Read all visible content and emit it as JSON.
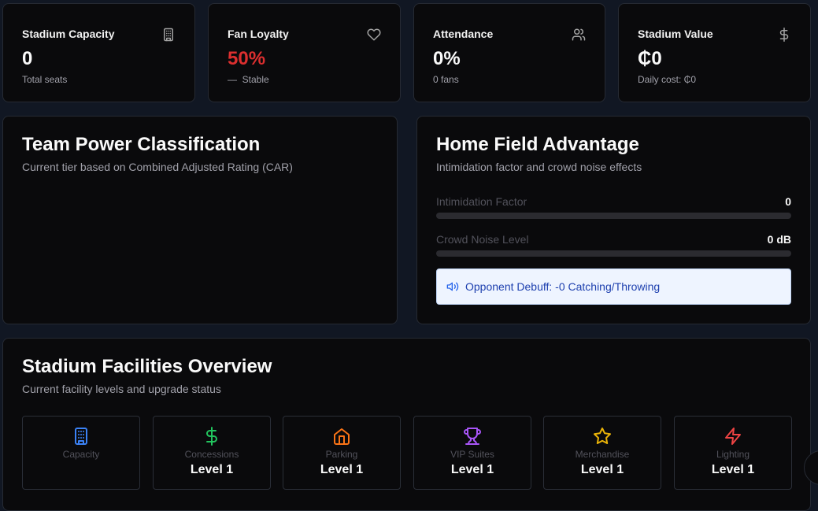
{
  "stats": [
    {
      "title": "Stadium Capacity",
      "value": "0",
      "sub": "Total seats",
      "icon": "building-icon"
    },
    {
      "title": "Fan Loyalty",
      "value": "50%",
      "sub": "Stable",
      "trend_symbol": "—",
      "icon": "heart-icon",
      "value_color": "#dc2f2f"
    },
    {
      "title": "Attendance",
      "value": "0%",
      "sub": "0 fans",
      "icon": "users-icon"
    },
    {
      "title": "Stadium Value",
      "value": "₵0",
      "sub": "Daily cost: ₵0",
      "icon": "dollar-icon"
    }
  ],
  "team_power": {
    "title": "Team Power Classification",
    "subtitle": "Current tier based on Combined Adjusted Rating (CAR)"
  },
  "home_field": {
    "title": "Home Field Advantage",
    "subtitle": "Intimidation factor and crowd noise effects",
    "metrics": [
      {
        "label": "Intimidation Factor",
        "value": "0",
        "progress": 0
      },
      {
        "label": "Crowd Noise Level",
        "value": "0 dB",
        "progress": 0
      }
    ],
    "debuff": "Opponent Debuff: -0 Catching/Throwing"
  },
  "facilities": {
    "title": "Stadium Facilities Overview",
    "subtitle": "Current facility levels and upgrade status",
    "items": [
      {
        "name": "Capacity",
        "level": "",
        "icon": "building-icon",
        "color": "#3b82f6"
      },
      {
        "name": "Concessions",
        "level": "Level 1",
        "icon": "dollar-icon",
        "color": "#22c55e"
      },
      {
        "name": "Parking",
        "level": "Level 1",
        "icon": "home-icon",
        "color": "#f97316"
      },
      {
        "name": "VIP Suites",
        "level": "Level 1",
        "icon": "trophy-icon",
        "color": "#a855f7"
      },
      {
        "name": "Merchandise",
        "level": "Level 1",
        "icon": "star-icon",
        "color": "#eab308"
      },
      {
        "name": "Lighting",
        "level": "Level 1",
        "icon": "zap-icon",
        "color": "#ef4444"
      }
    ]
  }
}
